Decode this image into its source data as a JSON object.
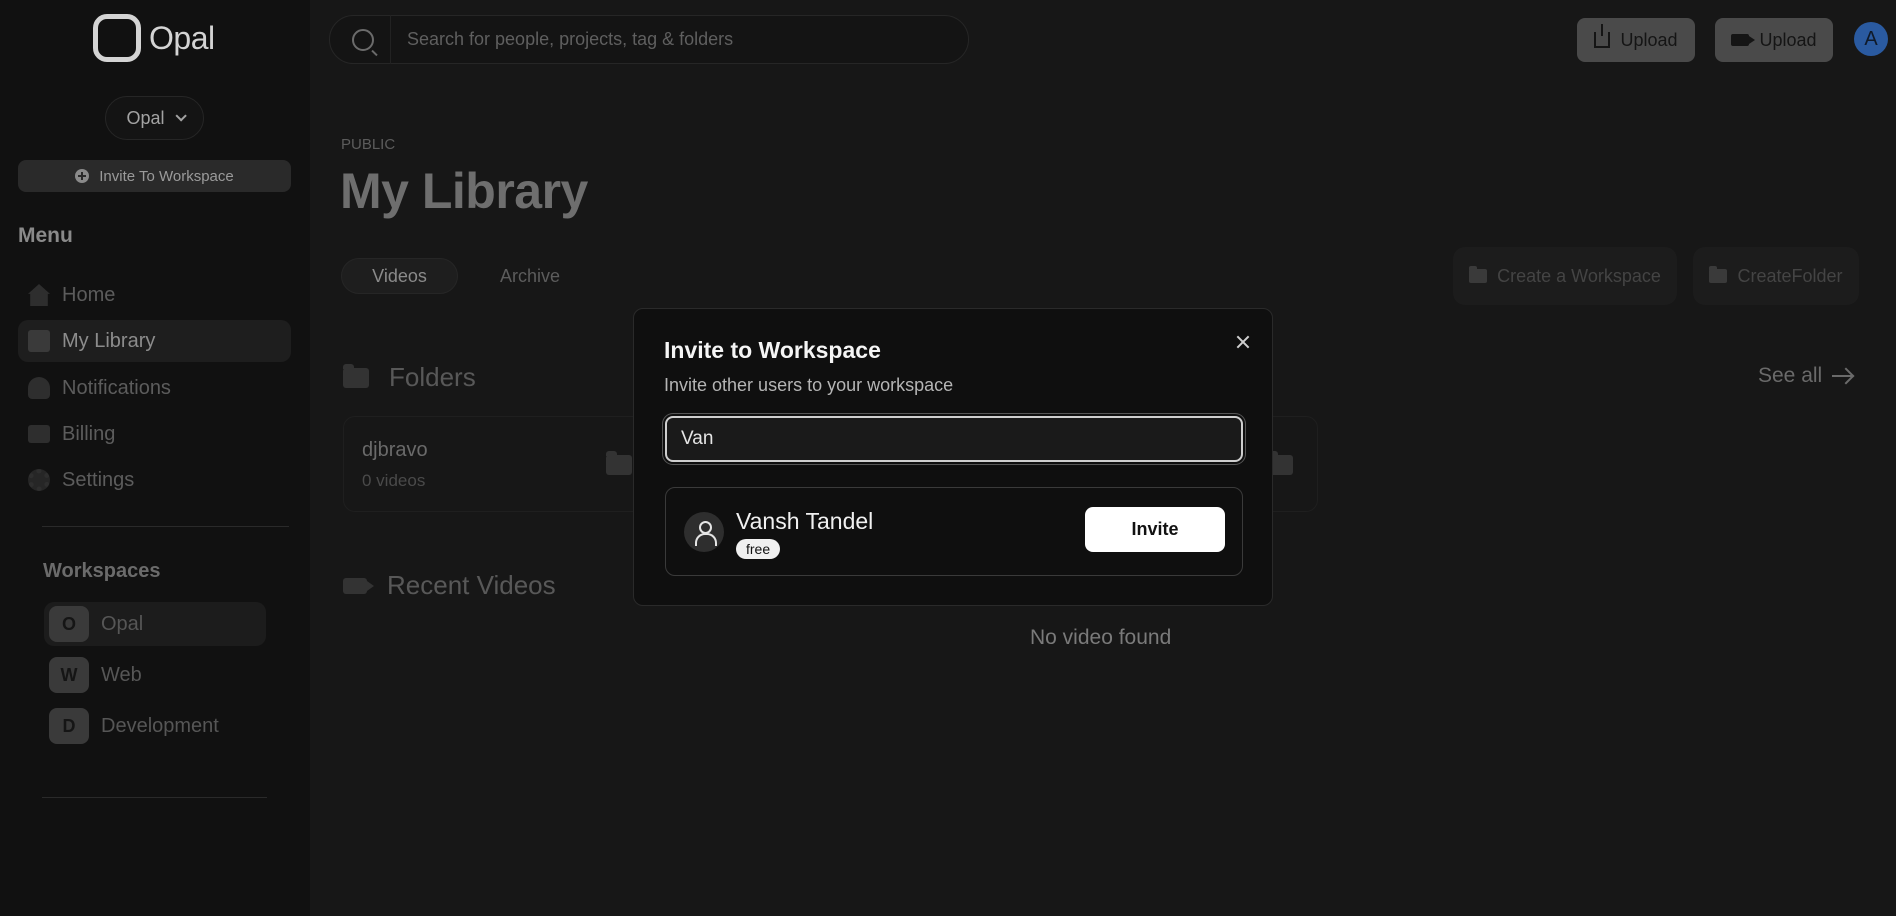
{
  "app": {
    "name": "Opal"
  },
  "sidebar": {
    "workspace_selector": "Opal",
    "invite_button": "Invite To Workspace",
    "menu_title": "Menu",
    "menu_items": [
      {
        "label": "Home",
        "icon": "home-icon"
      },
      {
        "label": "My Library",
        "icon": "library-icon",
        "active": true
      },
      {
        "label": "Notifications",
        "icon": "bell-icon"
      },
      {
        "label": "Billing",
        "icon": "credit-card-icon"
      },
      {
        "label": "Settings",
        "icon": "gear-icon"
      }
    ],
    "workspaces_title": "Workspaces",
    "workspaces": [
      {
        "initial": "O",
        "name": "Opal",
        "active": true
      },
      {
        "initial": "W",
        "name": "Web"
      },
      {
        "initial": "D",
        "name": "Development"
      }
    ]
  },
  "header": {
    "search_placeholder": "Search for people, projects, tag & folders",
    "upload_label": "Upload",
    "record_upload_label": "Upload",
    "avatar_initial": "A"
  },
  "main": {
    "visibility_label": "PUBLIC",
    "title": "My Library",
    "tabs": [
      {
        "label": "Videos",
        "active": true
      },
      {
        "label": "Archive"
      }
    ],
    "create_workspace_label": "Create a Workspace",
    "create_folder_label": "CreateFolder",
    "folders_title": "Folders",
    "see_all_label": "See all",
    "folders": [
      {
        "name": "djbravo",
        "count": "0 videos"
      }
    ],
    "recent_videos_title": "Recent Videos",
    "empty_videos": "No video found"
  },
  "modal": {
    "title": "Invite to Workspace",
    "subtitle": "Invite other users to your workspace",
    "search_value": "Van",
    "results": [
      {
        "name": "Vansh Tandel",
        "plan": "free",
        "action": "Invite"
      }
    ]
  },
  "colors": {
    "accent": "#2a5aa0",
    "background": "#171717",
    "modal_bg": "#0f0f0f"
  }
}
